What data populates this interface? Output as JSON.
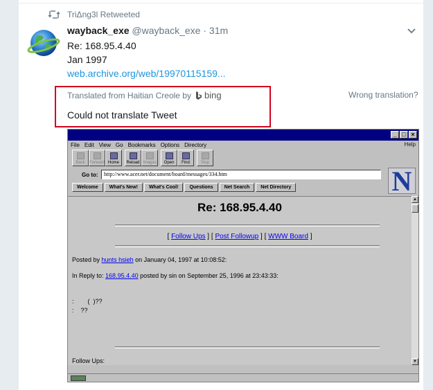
{
  "retweet": {
    "label": "TriΔng3l Retweeted"
  },
  "tweet": {
    "name": "wayback_exe",
    "handle": "@wayback_exe",
    "separator": "·",
    "time": "31m",
    "lines": [
      "Re: 168.95.4.40",
      "Jan 1997"
    ],
    "link": "web.archive.org/web/19970115159..."
  },
  "translation": {
    "from": "Translated from Haitian Creole by",
    "provider": "bing",
    "wrong": "Wrong translation?",
    "result": "Could not translate Tweet"
  },
  "browser": {
    "menu": [
      "File",
      "Edit",
      "View",
      "Go",
      "Bookmarks",
      "Options",
      "Directory"
    ],
    "help": "Help",
    "toolbar": [
      {
        "label": "Back",
        "disabled": true
      },
      {
        "label": "Forward",
        "disabled": true
      },
      {
        "label": "Home",
        "disabled": false
      },
      {
        "label": "Reload",
        "disabled": false
      },
      {
        "label": "Images",
        "disabled": true
      },
      {
        "label": "Open",
        "disabled": false
      },
      {
        "label": "Find",
        "disabled": false
      },
      {
        "label": "Stop",
        "disabled": true
      }
    ],
    "goto_label": "Go to:",
    "url": "http://www.acer.net/document/board/messages/334.htm",
    "dir_buttons": [
      "Welcome",
      "What's New!",
      "What's Cool!",
      "Questions",
      "Net Search",
      "Net Directory"
    ],
    "logo": "N",
    "page": {
      "title": "Re: 168.95.4.40",
      "links": [
        "Follow Ups",
        "Post Followup",
        "WWW Board"
      ],
      "posted_prefix": "Posted by",
      "posted_by": "hunts hsieh",
      "posted_suffix": "on January 04, 1997 at 10:08:52:",
      "reply_prefix": "In Reply to:",
      "reply_link": "168.95.4.40",
      "reply_suffix": "posted by sin on September 25, 1996 at 23:43:33:",
      "body_line1": ":        (  )??",
      "body_line2": ":    ??",
      "followups": "Follow Ups:"
    }
  },
  "colors": {
    "red_box": "#d0021b",
    "link": "#1b95e0",
    "muted": "#657786"
  }
}
